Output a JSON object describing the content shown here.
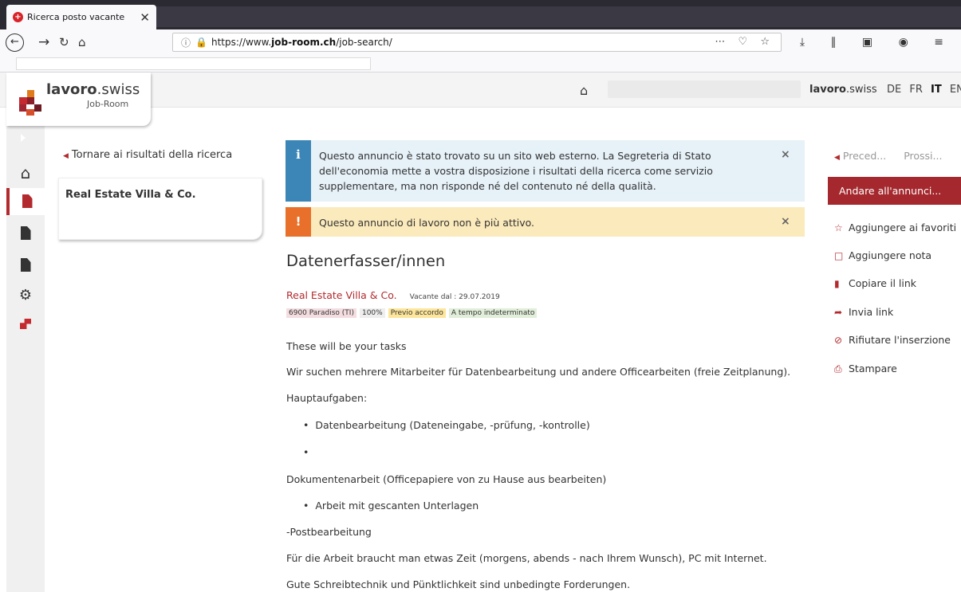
{
  "browser": {
    "tab_title": "Ricerca posto vacante",
    "tab_close": "✕",
    "url_prefix": "https://www.",
    "url_domain": "job-room.ch",
    "url_path": "/job-search/"
  },
  "header": {
    "logo_bold": "lavoro",
    "logo_rest": ".swiss",
    "logo_sub": "Job-Room",
    "brand_bold": "lavoro",
    "brand_rest": ".swiss",
    "languages": [
      "DE",
      "FR",
      "IT",
      "EN"
    ],
    "active_language": "IT"
  },
  "sidebar": {
    "items": [
      "expand",
      "home",
      "job-search",
      "documents",
      "favorites",
      "settings",
      "logo"
    ]
  },
  "left": {
    "back_link": "Tornare ai risultati della ricerca",
    "company_card_title": "Real Estate Villa & Co."
  },
  "alerts": {
    "info_icon": "i",
    "info_text": "Questo annuncio è stato trovato su un sito web esterno. La Segreteria di Stato dell'economia mette a vostra disposizione i risultati della ricerca come servizio supplementare, ma non risponde né del contenuto né della qualità.",
    "warn_icon": "!",
    "warn_text": "Questo annuncio di lavoro non è più attivo.",
    "close": "×"
  },
  "job": {
    "title": "Datenerfasser/innen",
    "company": "Real Estate Villa & Co.",
    "vacancy": "Vacante dal : 29.07.2019",
    "tags": {
      "location": "6900 Paradiso (TI)",
      "workload": "100%",
      "start": "Previo accordo",
      "contract": "A tempo indeterminato"
    },
    "description": {
      "p1": "These will be your tasks",
      "p2": "Wir suchen mehrere Mitarbeiter für Datenbearbeitung und andere Officearbeiten (freie Zeitplanung).",
      "p3": "Hauptaufgaben:",
      "b1": "Datenbearbeitung (Dateneingabe, -prüfung, -kontrolle)",
      "b2": "",
      "p4": "Dokumentenarbeit (Officepapiere von zu Hause aus bearbeiten)",
      "b3": "Arbeit mit gescanten Unterlagen",
      "p5": "-Postbearbeitung",
      "p6": "Für die Arbeit braucht man etwas Zeit (morgens, abends - nach Ihrem Wunsch), PC mit Internet.",
      "p7": "Gute Schreibtechnik und Pünktlichkeit sind unbedingte Forderungen."
    }
  },
  "right": {
    "prev": "Preced...",
    "next": "Prossi...",
    "go_button": "Andare all'annunci...",
    "actions": {
      "favorite": "Aggiungere ai favoriti",
      "note": "Aggiungere nota",
      "copy": "Copiare il link",
      "send": "Invia link",
      "reject": "Rifiutare l'inserzione",
      "print": "Stampare"
    }
  },
  "colors": {
    "accent": "#a4282d",
    "info": "#3b86b7",
    "warning": "#e8702a"
  }
}
